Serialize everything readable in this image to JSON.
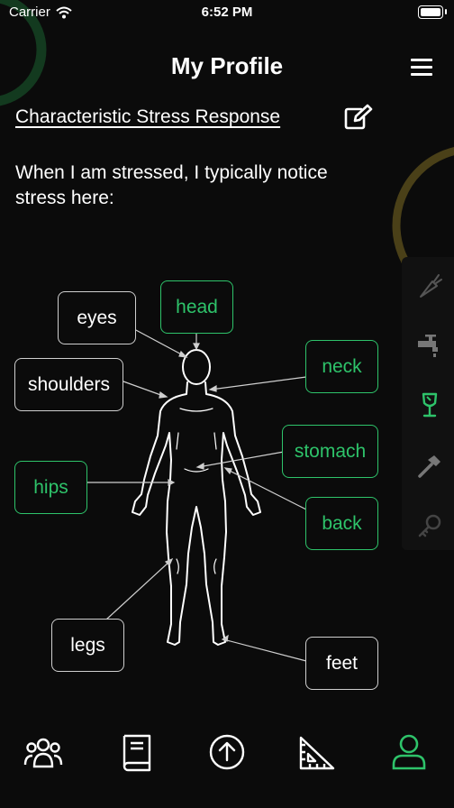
{
  "status_bar": {
    "carrier": "Carrier",
    "time": "6:52 PM"
  },
  "header": {
    "title": "My Profile"
  },
  "section": {
    "link_text": "Characteristic Stress Response",
    "intro": "When I am stressed, I typically notice stress here:"
  },
  "body_labels": [
    {
      "text": "eyes",
      "selected": false
    },
    {
      "text": "head",
      "selected": true
    },
    {
      "text": "shoulders",
      "selected": false
    },
    {
      "text": "neck",
      "selected": true
    },
    {
      "text": "stomach",
      "selected": true
    },
    {
      "text": "hips",
      "selected": true
    },
    {
      "text": "back",
      "selected": true
    },
    {
      "text": "legs",
      "selected": false
    },
    {
      "text": "feet",
      "selected": false
    }
  ],
  "side_tools": [
    "carrot-icon",
    "faucet-icon",
    "glass-icon",
    "hammer-icon",
    "key-icon"
  ],
  "tabs": [
    "community-icon",
    "book-icon",
    "upload-icon",
    "ruler-icon",
    "profile-icon"
  ],
  "colors": {
    "accent": "#2ec36a",
    "background": "#0b0b0b",
    "olive_ring": "#5a4d1c",
    "green_ring": "#13391f"
  }
}
